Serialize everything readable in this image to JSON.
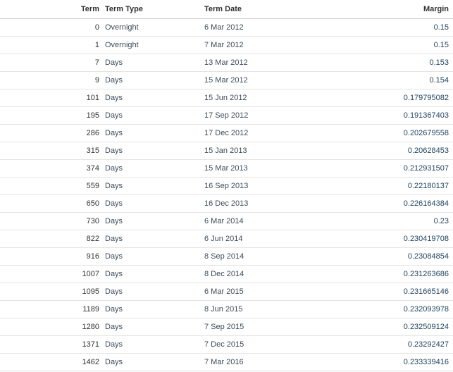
{
  "table": {
    "columns": {
      "term": "Term",
      "term_type": "Term Type",
      "term_date": "Term Date",
      "margin": "Margin"
    },
    "rows": [
      {
        "term": "0",
        "term_type": "Overnight",
        "term_date": "6 Mar 2012",
        "margin": "0.15"
      },
      {
        "term": "1",
        "term_type": "Overnight",
        "term_date": "7 Mar 2012",
        "margin": "0.15"
      },
      {
        "term": "7",
        "term_type": "Days",
        "term_date": "13 Mar 2012",
        "margin": "0.153"
      },
      {
        "term": "9",
        "term_type": "Days",
        "term_date": "15 Mar 2012",
        "margin": "0.154"
      },
      {
        "term": "101",
        "term_type": "Days",
        "term_date": "15 Jun 2012",
        "margin": "0.179795082"
      },
      {
        "term": "195",
        "term_type": "Days",
        "term_date": "17 Sep 2012",
        "margin": "0.191367403"
      },
      {
        "term": "286",
        "term_type": "Days",
        "term_date": "17 Dec 2012",
        "margin": "0.202679558"
      },
      {
        "term": "315",
        "term_type": "Days",
        "term_date": "15 Jan 2013",
        "margin": "0.20628453"
      },
      {
        "term": "374",
        "term_type": "Days",
        "term_date": "15 Mar 2013",
        "margin": "0.212931507"
      },
      {
        "term": "559",
        "term_type": "Days",
        "term_date": "16 Sep 2013",
        "margin": "0.22180137"
      },
      {
        "term": "650",
        "term_type": "Days",
        "term_date": "16 Dec 2013",
        "margin": "0.226164384"
      },
      {
        "term": "730",
        "term_type": "Days",
        "term_date": "6 Mar 2014",
        "margin": "0.23"
      },
      {
        "term": "822",
        "term_type": "Days",
        "term_date": "6 Jun 2014",
        "margin": "0.230419708"
      },
      {
        "term": "916",
        "term_type": "Days",
        "term_date": "8 Sep 2014",
        "margin": "0.23084854"
      },
      {
        "term": "1007",
        "term_type": "Days",
        "term_date": "8 Dec 2014",
        "margin": "0.231263686"
      },
      {
        "term": "1095",
        "term_type": "Days",
        "term_date": "6 Mar 2015",
        "margin": "0.231665146"
      },
      {
        "term": "1189",
        "term_type": "Days",
        "term_date": "8 Jun 2015",
        "margin": "0.232093978"
      },
      {
        "term": "1280",
        "term_type": "Days",
        "term_date": "7 Sep 2015",
        "margin": "0.232509124"
      },
      {
        "term": "1371",
        "term_type": "Days",
        "term_date": "7 Dec 2015",
        "margin": "0.23292427"
      },
      {
        "term": "1462",
        "term_type": "Days",
        "term_date": "7 Mar 2016",
        "margin": "0.233339416"
      }
    ]
  }
}
